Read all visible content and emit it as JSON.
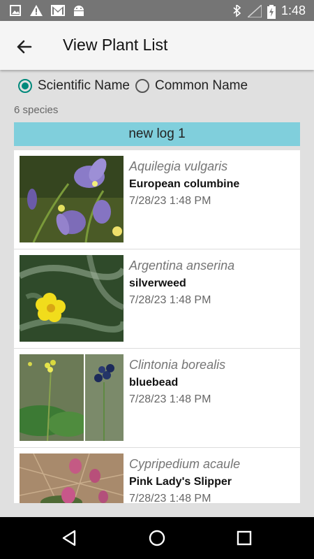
{
  "status_bar": {
    "time": "1:48",
    "left_icons": [
      "image-icon",
      "alert-icon",
      "gmail-icon",
      "android-icon"
    ],
    "right_icons": [
      "bluetooth-icon",
      "signal-icon",
      "battery-charging-icon"
    ]
  },
  "app_bar": {
    "title": "View Plant List",
    "back_icon": "arrow-left-icon"
  },
  "sort": {
    "options": [
      {
        "label": "Scientific Name",
        "checked": true
      },
      {
        "label": "Common Name",
        "checked": false
      }
    ]
  },
  "species_count": "6 species",
  "log_name": "new log 1",
  "plants": [
    {
      "scientific": "Aquilegia vulgaris",
      "common": "European columbine",
      "date": "7/28/23 1:48 PM"
    },
    {
      "scientific": "Argentina anserina",
      "common": "silverweed",
      "date": "7/28/23 1:48 PM"
    },
    {
      "scientific": "Clintonia borealis",
      "common": "bluebead",
      "date": "7/28/23 1:48 PM"
    },
    {
      "scientific": "Cypripedium acaule",
      "common": "Pink Lady's Slipper",
      "date": "7/28/23 1:48 PM"
    }
  ],
  "colors": {
    "accent": "#00897b",
    "log_bar": "#80cfdc",
    "status_bar": "#757575"
  },
  "nav_bar": {
    "icons": [
      "back-triangle-icon",
      "home-circle-icon",
      "recents-square-icon"
    ]
  }
}
